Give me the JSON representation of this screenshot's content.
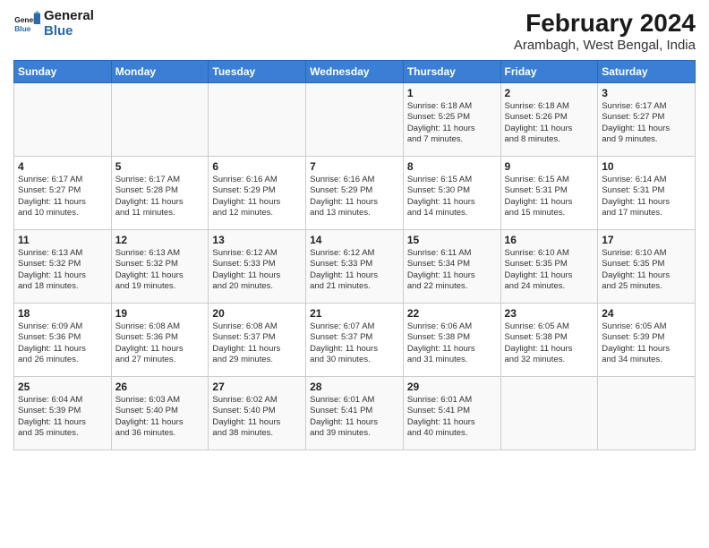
{
  "header": {
    "logo_line1": "General",
    "logo_line2": "Blue",
    "title": "February 2024",
    "subtitle": "Arambagh, West Bengal, India"
  },
  "weekdays": [
    "Sunday",
    "Monday",
    "Tuesday",
    "Wednesday",
    "Thursday",
    "Friday",
    "Saturday"
  ],
  "weeks": [
    [
      {
        "day": "",
        "info": ""
      },
      {
        "day": "",
        "info": ""
      },
      {
        "day": "",
        "info": ""
      },
      {
        "day": "",
        "info": ""
      },
      {
        "day": "1",
        "info": "Sunrise: 6:18 AM\nSunset: 5:25 PM\nDaylight: 11 hours\nand 7 minutes."
      },
      {
        "day": "2",
        "info": "Sunrise: 6:18 AM\nSunset: 5:26 PM\nDaylight: 11 hours\nand 8 minutes."
      },
      {
        "day": "3",
        "info": "Sunrise: 6:17 AM\nSunset: 5:27 PM\nDaylight: 11 hours\nand 9 minutes."
      }
    ],
    [
      {
        "day": "4",
        "info": "Sunrise: 6:17 AM\nSunset: 5:27 PM\nDaylight: 11 hours\nand 10 minutes."
      },
      {
        "day": "5",
        "info": "Sunrise: 6:17 AM\nSunset: 5:28 PM\nDaylight: 11 hours\nand 11 minutes."
      },
      {
        "day": "6",
        "info": "Sunrise: 6:16 AM\nSunset: 5:29 PM\nDaylight: 11 hours\nand 12 minutes."
      },
      {
        "day": "7",
        "info": "Sunrise: 6:16 AM\nSunset: 5:29 PM\nDaylight: 11 hours\nand 13 minutes."
      },
      {
        "day": "8",
        "info": "Sunrise: 6:15 AM\nSunset: 5:30 PM\nDaylight: 11 hours\nand 14 minutes."
      },
      {
        "day": "9",
        "info": "Sunrise: 6:15 AM\nSunset: 5:31 PM\nDaylight: 11 hours\nand 15 minutes."
      },
      {
        "day": "10",
        "info": "Sunrise: 6:14 AM\nSunset: 5:31 PM\nDaylight: 11 hours\nand 17 minutes."
      }
    ],
    [
      {
        "day": "11",
        "info": "Sunrise: 6:13 AM\nSunset: 5:32 PM\nDaylight: 11 hours\nand 18 minutes."
      },
      {
        "day": "12",
        "info": "Sunrise: 6:13 AM\nSunset: 5:32 PM\nDaylight: 11 hours\nand 19 minutes."
      },
      {
        "day": "13",
        "info": "Sunrise: 6:12 AM\nSunset: 5:33 PM\nDaylight: 11 hours\nand 20 minutes."
      },
      {
        "day": "14",
        "info": "Sunrise: 6:12 AM\nSunset: 5:33 PM\nDaylight: 11 hours\nand 21 minutes."
      },
      {
        "day": "15",
        "info": "Sunrise: 6:11 AM\nSunset: 5:34 PM\nDaylight: 11 hours\nand 22 minutes."
      },
      {
        "day": "16",
        "info": "Sunrise: 6:10 AM\nSunset: 5:35 PM\nDaylight: 11 hours\nand 24 minutes."
      },
      {
        "day": "17",
        "info": "Sunrise: 6:10 AM\nSunset: 5:35 PM\nDaylight: 11 hours\nand 25 minutes."
      }
    ],
    [
      {
        "day": "18",
        "info": "Sunrise: 6:09 AM\nSunset: 5:36 PM\nDaylight: 11 hours\nand 26 minutes."
      },
      {
        "day": "19",
        "info": "Sunrise: 6:08 AM\nSunset: 5:36 PM\nDaylight: 11 hours\nand 27 minutes."
      },
      {
        "day": "20",
        "info": "Sunrise: 6:08 AM\nSunset: 5:37 PM\nDaylight: 11 hours\nand 29 minutes."
      },
      {
        "day": "21",
        "info": "Sunrise: 6:07 AM\nSunset: 5:37 PM\nDaylight: 11 hours\nand 30 minutes."
      },
      {
        "day": "22",
        "info": "Sunrise: 6:06 AM\nSunset: 5:38 PM\nDaylight: 11 hours\nand 31 minutes."
      },
      {
        "day": "23",
        "info": "Sunrise: 6:05 AM\nSunset: 5:38 PM\nDaylight: 11 hours\nand 32 minutes."
      },
      {
        "day": "24",
        "info": "Sunrise: 6:05 AM\nSunset: 5:39 PM\nDaylight: 11 hours\nand 34 minutes."
      }
    ],
    [
      {
        "day": "25",
        "info": "Sunrise: 6:04 AM\nSunset: 5:39 PM\nDaylight: 11 hours\nand 35 minutes."
      },
      {
        "day": "26",
        "info": "Sunrise: 6:03 AM\nSunset: 5:40 PM\nDaylight: 11 hours\nand 36 minutes."
      },
      {
        "day": "27",
        "info": "Sunrise: 6:02 AM\nSunset: 5:40 PM\nDaylight: 11 hours\nand 38 minutes."
      },
      {
        "day": "28",
        "info": "Sunrise: 6:01 AM\nSunset: 5:41 PM\nDaylight: 11 hours\nand 39 minutes."
      },
      {
        "day": "29",
        "info": "Sunrise: 6:01 AM\nSunset: 5:41 PM\nDaylight: 11 hours\nand 40 minutes."
      },
      {
        "day": "",
        "info": ""
      },
      {
        "day": "",
        "info": ""
      }
    ]
  ]
}
